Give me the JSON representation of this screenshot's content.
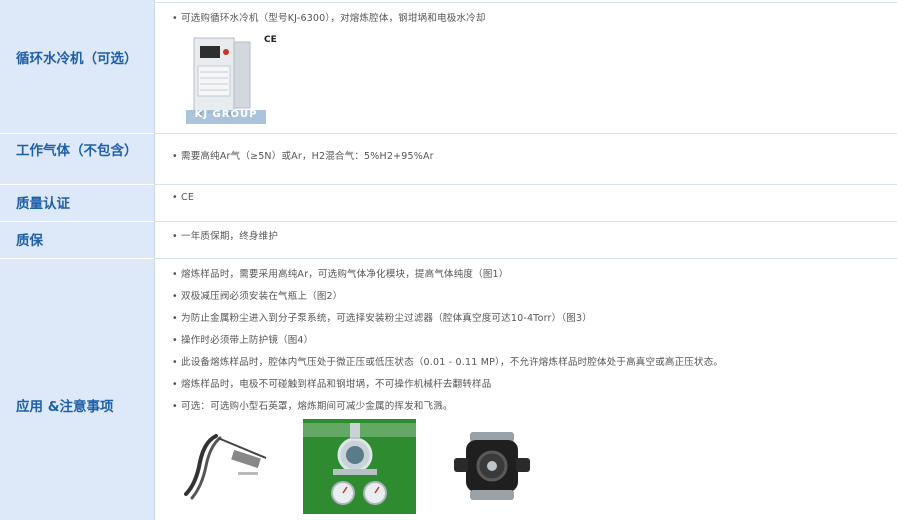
{
  "rows": [
    {
      "label": "循环水冷机（可选）",
      "lines": [
        "• 可选购循环水冷机（型号KJ-6300），对熔炼腔体，钢坩埚和电极水冷却"
      ],
      "ce_mark": "CE",
      "image_watermark": "KJ GROUP"
    },
    {
      "label": "工作气体（不包含）",
      "lines": [
        "• 需要高纯Ar气（≥5N）或Ar，H2混合气：5%H2+95%Ar"
      ]
    },
    {
      "label": "质量认证",
      "lines": [
        "• CE"
      ]
    },
    {
      "label": "质保",
      "lines": [
        "• 一年质保期，终身维护"
      ]
    },
    {
      "label": "应用 &注意事项",
      "lines": [
        "• 熔炼样品时，需要采用高纯Ar，可选购气体净化模块，提高气体纯度（图1）",
        "• 双极减压阀必须安装在气瓶上（图2）",
        "• 为防止金属粉尘进入到分子泵系统，可选择安装粉尘过滤器（腔体真空度可达10-4Torr）（图3）",
        "• 操作时必须带上防护镜（图4）",
        "•  此设备熔炼样品时，腔体内气压处于微正压或低压状态（0.01 - 0.11 MP），不允许熔炼样品时腔体处于高真空或高正压状态。",
        "• 熔炼样品时，电极不可碰触到样品和钢坩埚，不可操作机械杆去翻转样品",
        "• 可选：可选购小型石英罩，熔炼期间可减少金属的挥发和飞溅。"
      ]
    }
  ]
}
